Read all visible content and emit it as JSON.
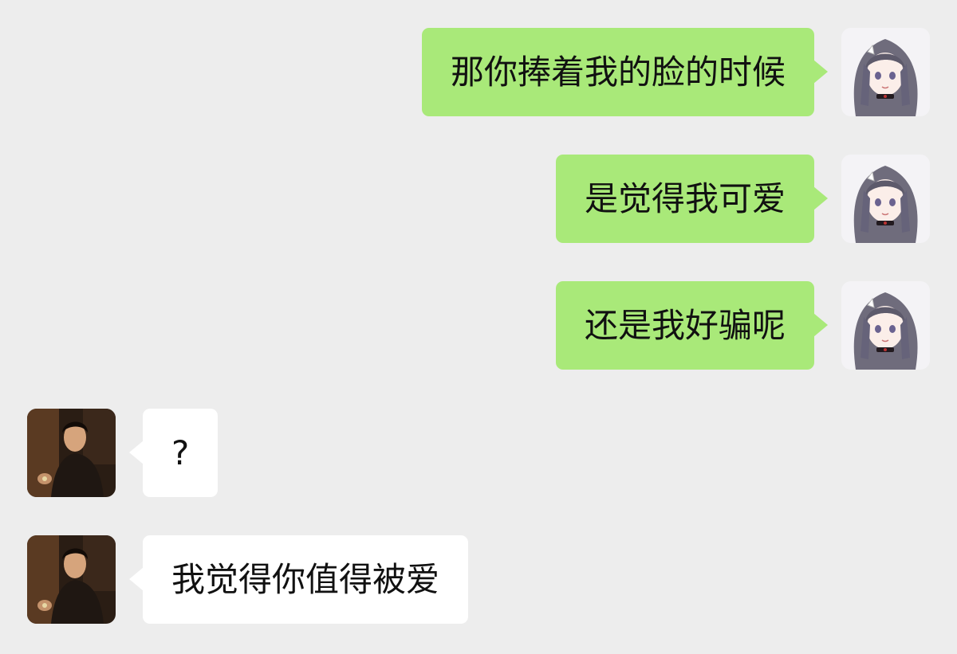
{
  "chat": {
    "messages": [
      {
        "sender": "self",
        "avatar": "anime-girl-avatar",
        "text": "那你捧着我的脸的时候"
      },
      {
        "sender": "self",
        "avatar": "anime-girl-avatar",
        "text": "是觉得我可爱"
      },
      {
        "sender": "self",
        "avatar": "anime-girl-avatar",
        "text": "还是我好骗呢"
      },
      {
        "sender": "other",
        "avatar": "man-portrait-avatar",
        "text": "?"
      },
      {
        "sender": "other",
        "avatar": "man-portrait-avatar",
        "text": "我觉得你值得被爱"
      }
    ]
  },
  "colors": {
    "background": "#ededed",
    "sent_bubble": "#a9e979",
    "received_bubble": "#ffffff"
  }
}
